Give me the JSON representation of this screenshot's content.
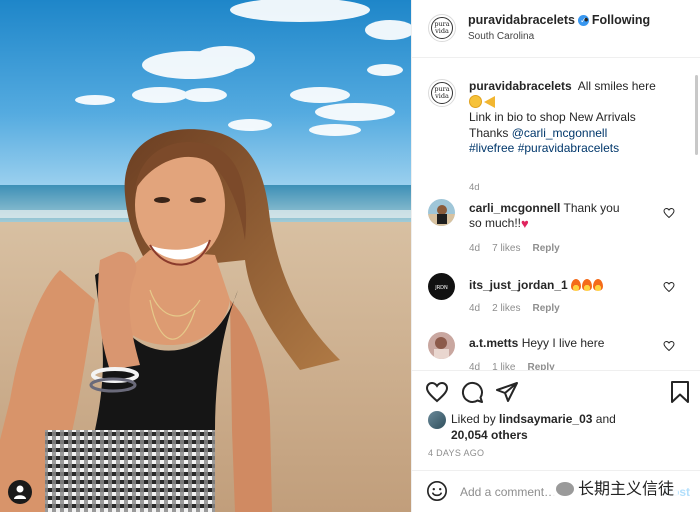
{
  "post": {
    "username": "puravidabracelets",
    "follow_status": "Following",
    "location": "South Carolina",
    "bullet": "•"
  },
  "logo": {
    "line1": "pura",
    "line2": "vida"
  },
  "caption": {
    "username": "puravidabracelets",
    "line1": "All smiles here",
    "line2": "Link in bio to shop New Arrivals",
    "line3_prefix": "Thanks ",
    "mention": "@carli_mcgonnell",
    "hashtag1": "#livefree",
    "hashtag2": "#puravidabracelets",
    "time": "4d"
  },
  "comments": [
    {
      "username": "carli_mcgonnell",
      "text": "Thank you so much!!",
      "emoji": "♥",
      "time": "4d",
      "likes": "7 likes",
      "reply": "Reply"
    },
    {
      "username": "its_just_jordan_1",
      "text": "",
      "time": "4d",
      "likes": "2 likes",
      "reply": "Reply"
    },
    {
      "username": "a.t.metts",
      "text": "Heyy I live here",
      "time": "4d",
      "likes": "1 like",
      "reply": "Reply"
    }
  ],
  "likes": {
    "prefix": "Liked by ",
    "user": "lindsaymarie_03",
    "and": " and",
    "count": "20,054 others"
  },
  "posted_date": "4 DAYS AGO",
  "add_comment": {
    "placeholder": "Add a comment…",
    "post_label": "Post"
  },
  "watermark": "长期主义信徒",
  "colors": {
    "link": "#00376b",
    "verified": "#3897f0",
    "meta": "#8e8e8e",
    "post_button": "#b2dffc"
  },
  "icons": [
    "heart-icon",
    "comment-icon",
    "share-icon",
    "bookmark-icon",
    "smile-icon",
    "verified-icon"
  ]
}
